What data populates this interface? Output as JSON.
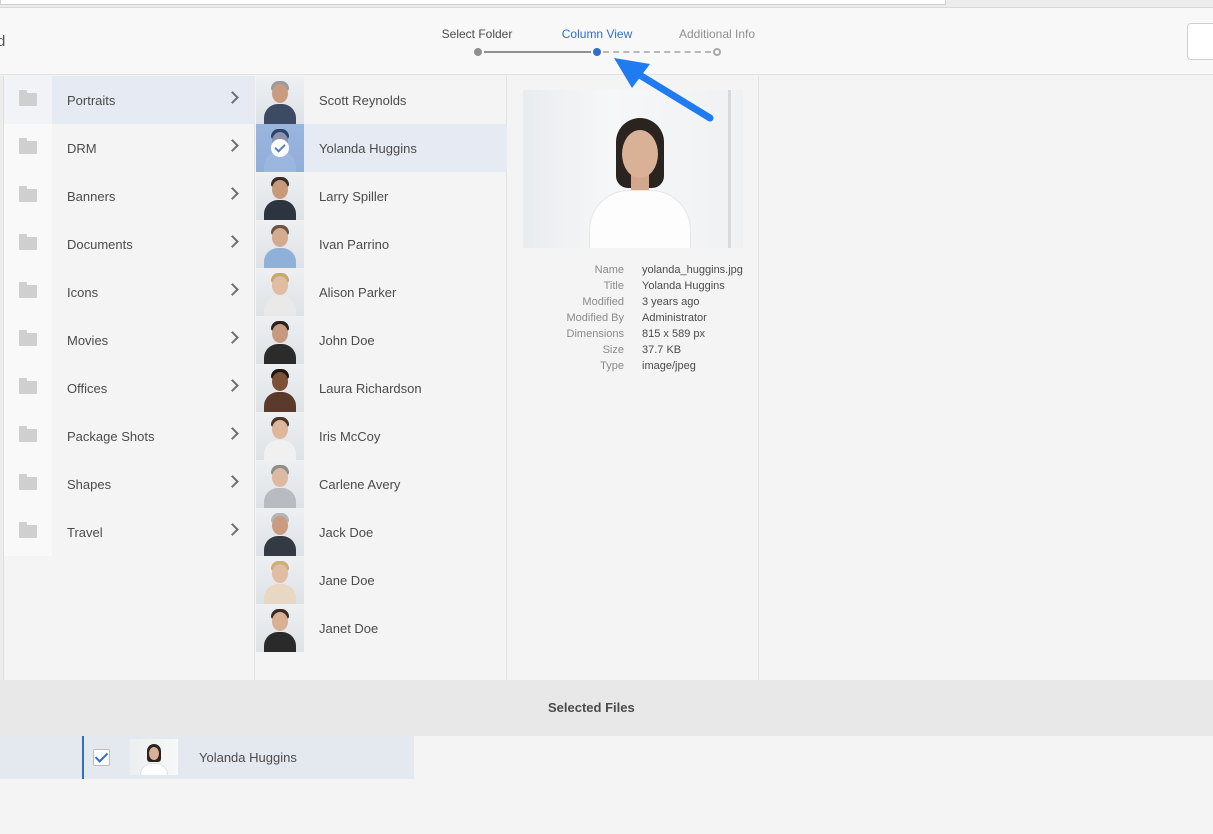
{
  "header": {
    "cut_label": "d",
    "steps": [
      {
        "label": "Select Folder",
        "state": "done"
      },
      {
        "label": "Column View",
        "state": "active"
      },
      {
        "label": "Additional Info",
        "state": "pending"
      }
    ]
  },
  "folders": [
    {
      "label": "Portraits",
      "selected": true
    },
    {
      "label": "DRM"
    },
    {
      "label": "Banners"
    },
    {
      "label": "Documents"
    },
    {
      "label": "Icons"
    },
    {
      "label": "Movies"
    },
    {
      "label": "Offices"
    },
    {
      "label": "Package Shots"
    },
    {
      "label": "Shapes"
    },
    {
      "label": "Travel"
    }
  ],
  "people": [
    {
      "label": "Scott Reynolds",
      "hair": "#9a9a9a",
      "body": "#3c4a63",
      "skin": "#c99c80"
    },
    {
      "label": "Yolanda Huggins",
      "hair": "#2b2320",
      "body": "#f2f2f2",
      "skin": "#d9b196",
      "selected": true
    },
    {
      "label": "Larry Spiller",
      "hair": "#3b2d25",
      "body": "#2b3440",
      "skin": "#c89a7c"
    },
    {
      "label": "Ivan Parrino",
      "hair": "#6a5444",
      "body": "#8fb0d8",
      "skin": "#d4ab8f"
    },
    {
      "label": "Alison Parker",
      "hair": "#c9a96b",
      "body": "#e9e9e9",
      "skin": "#e0bca2"
    },
    {
      "label": "John Doe",
      "hair": "#2a211c",
      "body": "#2b2b2b",
      "skin": "#c59a7e"
    },
    {
      "label": "Laura Richardson",
      "hair": "#1f1714",
      "body": "#5a3a2a",
      "skin": "#7b5238"
    },
    {
      "label": "Iris McCoy",
      "hair": "#4a3529",
      "body": "#f0f0f0",
      "skin": "#ddb69b"
    },
    {
      "label": "Carlene Avery",
      "hair": "#8d8d8d",
      "body": "#b8bcc2",
      "skin": "#dcb9a0"
    },
    {
      "label": "Jack Doe",
      "hair": "#b5b5b5",
      "body": "#333a44",
      "skin": "#c99b7f"
    },
    {
      "label": "Jane Doe",
      "hair": "#cfae72",
      "body": "#e7d7c3",
      "skin": "#e0bda3"
    },
    {
      "label": "Janet Doe",
      "hair": "#3d2a22",
      "body": "#2a2a2a",
      "skin": "#d8b094"
    }
  ],
  "details": {
    "rows": [
      {
        "key": "Name",
        "value": "yolanda_huggins.jpg"
      },
      {
        "key": "Title",
        "value": "Yolanda Huggins"
      },
      {
        "key": "Modified",
        "value": "3 years ago"
      },
      {
        "key": "Modified By",
        "value": "Administrator"
      },
      {
        "key": "Dimensions",
        "value": "815 x 589 px"
      },
      {
        "key": "Size",
        "value": "37.7 KB"
      },
      {
        "key": "Type",
        "value": "image/jpeg"
      }
    ]
  },
  "selected_files": {
    "title": "Selected Files",
    "items": [
      {
        "label": "Yolanda Huggins",
        "checked": true
      }
    ]
  },
  "colors": {
    "accent": "#326ec8",
    "arrow": "#1f7bf0",
    "selected_row": "#e6ebf3"
  }
}
